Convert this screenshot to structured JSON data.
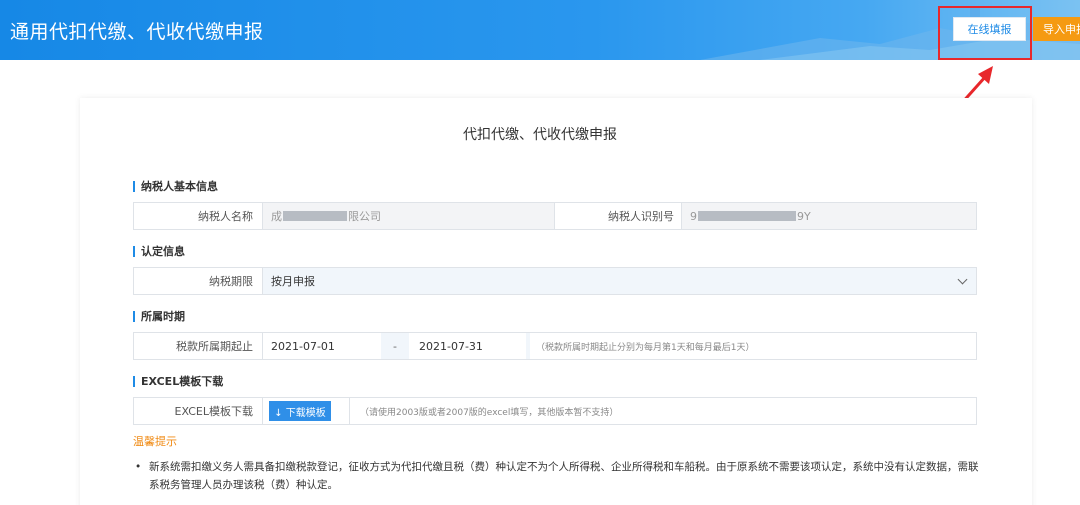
{
  "header": {
    "title": "通用代扣代缴、代收代缴申报",
    "online_button": "在线填报",
    "import_button": "导入申报"
  },
  "form": {
    "title": "代扣代缴、代收代缴申报"
  },
  "sections": {
    "basic_info": {
      "label": "纳税人基本信息",
      "name_label": "纳税人名称",
      "name_prefix": "成",
      "name_suffix": "限公司",
      "id_label": "纳税人识别号",
      "id_prefix": "9",
      "id_suffix": "9Y"
    },
    "certification": {
      "label": "认定信息",
      "period_label": "纳税期限",
      "period_value": "按月申报"
    },
    "period": {
      "label": "所属时期",
      "start_label": "税款所属期起止",
      "start_date": "2021-07-01",
      "separator": "-",
      "end_date": "2021-07-31",
      "hint": "（税款所属时期起止分别为每月第1天和每月最后1天）"
    },
    "excel": {
      "label": "EXCEL模板下载",
      "download_label": "EXCEL模板下载",
      "download_button": "↓ 下载模板",
      "hint": "（请使用2003版或者2007版的excel填写，其他版本暂不支持）"
    }
  },
  "tips": {
    "title": "温馨提示",
    "bullet": "•",
    "text": "新系统需扣缴义务人需具备扣缴税款登记，征收方式为代扣代缴且税（费）种认定不为个人所得税、企业所得税和车船税。由于原系统不需要该项认定，系统中没有认定数据，需联系税务管理人员办理该税（费）种认定。"
  },
  "colors": {
    "header_blue": "#1688e6",
    "import_orange": "#f59a12",
    "annotation_red": "#e8272b",
    "tip_orange": "#f08a13"
  }
}
